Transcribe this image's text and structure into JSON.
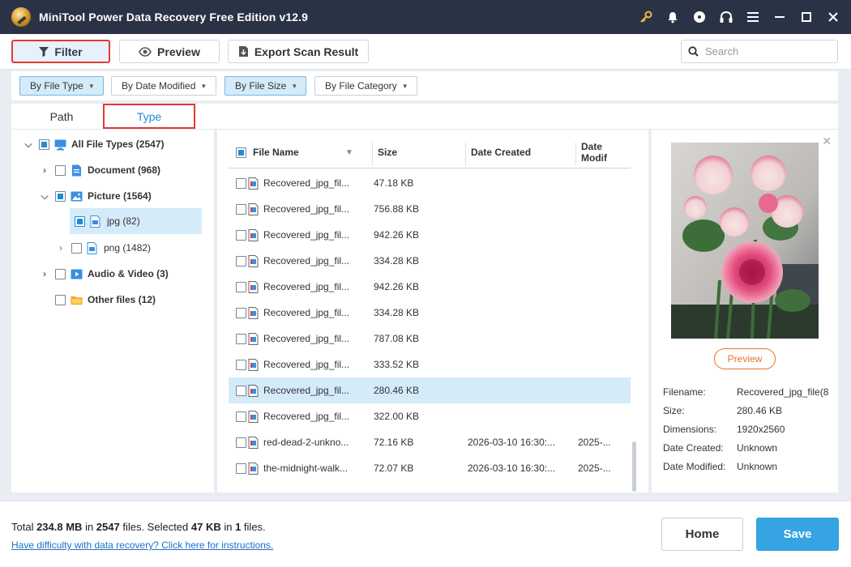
{
  "app": {
    "title": "MiniTool Power Data Recovery Free Edition v12.9"
  },
  "toolbar": {
    "filter_label": "Filter",
    "preview_label": "Preview",
    "export_label": "Export Scan Result",
    "search_placeholder": "Search"
  },
  "filters": {
    "by_file_type": "By File Type",
    "by_date_modified": "By Date Modified",
    "by_file_size": "By File Size",
    "by_file_category": "By File Category"
  },
  "tabs": {
    "path": "Path",
    "type": "Type"
  },
  "tree": {
    "all": "All File Types (2547)",
    "document": "Document (968)",
    "picture": "Picture (1564)",
    "jpg": "jpg (82)",
    "png": "png (1482)",
    "audio_video": "Audio & Video (3)",
    "other": "Other files (12)"
  },
  "columns": {
    "name": "File Name",
    "size": "Size",
    "created": "Date Created",
    "modified": "Date Modif"
  },
  "files": [
    {
      "name": "Recovered_jpg_fil...",
      "size": "47.18 KB",
      "created": "",
      "modified": ""
    },
    {
      "name": "Recovered_jpg_fil...",
      "size": "756.88 KB",
      "created": "",
      "modified": ""
    },
    {
      "name": "Recovered_jpg_fil...",
      "size": "942.26 KB",
      "created": "",
      "modified": ""
    },
    {
      "name": "Recovered_jpg_fil...",
      "size": "334.28 KB",
      "created": "",
      "modified": ""
    },
    {
      "name": "Recovered_jpg_fil...",
      "size": "942.26 KB",
      "created": "",
      "modified": ""
    },
    {
      "name": "Recovered_jpg_fil...",
      "size": "334.28 KB",
      "created": "",
      "modified": ""
    },
    {
      "name": "Recovered_jpg_fil...",
      "size": "787.08 KB",
      "created": "",
      "modified": ""
    },
    {
      "name": "Recovered_jpg_fil...",
      "size": "333.52 KB",
      "created": "",
      "modified": ""
    },
    {
      "name": "Recovered_jpg_fil...",
      "size": "280.46 KB",
      "created": "",
      "modified": ""
    },
    {
      "name": "Recovered_jpg_fil...",
      "size": "322.00 KB",
      "created": "",
      "modified": ""
    },
    {
      "name": "red-dead-2-unkno...",
      "size": "72.16 KB",
      "created": "2026-03-10 16:30:...",
      "modified": "2025-..."
    },
    {
      "name": "the-midnight-walk...",
      "size": "72.07 KB",
      "created": "2026-03-10 16:30:...",
      "modified": "2025-..."
    }
  ],
  "preview": {
    "button": "Preview",
    "filename_label": "Filename:",
    "filename": "Recovered_jpg_file(8",
    "size_label": "Size:",
    "size": "280.46 KB",
    "dimensions_label": "Dimensions:",
    "dimensions": "1920x2560",
    "created_label": "Date Created:",
    "created": "Unknown",
    "modified_label": "Date Modified:",
    "modified": "Unknown"
  },
  "footer": {
    "total_prefix": "Total ",
    "total_size": "234.8 MB",
    "in1": " in ",
    "total_files": "2547",
    "files_selected": " files.  Selected ",
    "selected_size": "47 KB",
    "in2": " in ",
    "selected_count": "1",
    "files_end": " files.",
    "help_link": "Have difficulty with data recovery? Click here for instructions.",
    "home": "Home",
    "save": "Save"
  },
  "colors": {
    "titlebar": "#2a3245",
    "accent": "#1f8bd6",
    "highlight_border": "#e53935",
    "save_button": "#36a3e2",
    "preview_button": "#e8742a",
    "selected_row": "#d4ebfa"
  }
}
